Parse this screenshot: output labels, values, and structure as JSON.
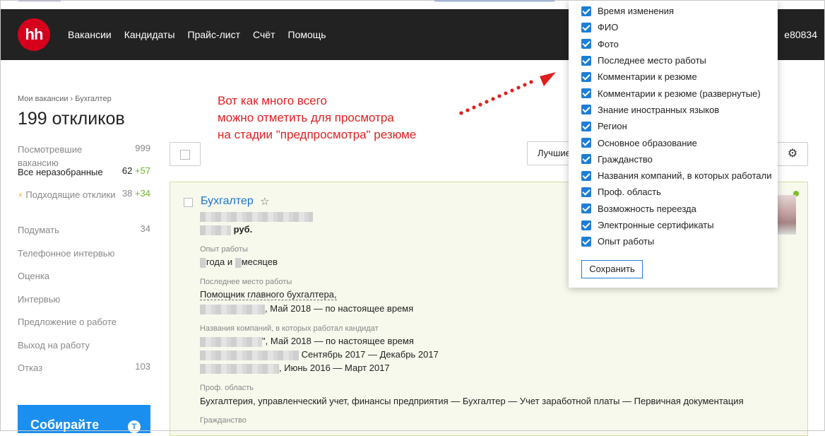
{
  "header": {
    "logo": "hh",
    "nav": [
      "Вакансии",
      "Кандидаты",
      "Прайс-лист",
      "Счёт",
      "Помощь"
    ],
    "user": "e80834"
  },
  "breadcrumb": "Мои вакансии › Бухгалтер",
  "page_title": "199 откликов",
  "sidebar": [
    {
      "label": "Посмотревшие вакансию",
      "count": "999",
      "plus": ""
    },
    {
      "label": "Все неразобранные",
      "count": "62",
      "plus": "+57"
    },
    {
      "label": "Подходящие отклики",
      "count": "38",
      "plus": "+34",
      "icon": "lightning-icon"
    },
    {
      "label": "Подумать",
      "count": "34",
      "plus": ""
    },
    {
      "label": "Телефонное интервью",
      "count": "",
      "plus": ""
    },
    {
      "label": "Оценка",
      "count": "",
      "plus": ""
    },
    {
      "label": "Интервью",
      "count": "",
      "plus": ""
    },
    {
      "label": "Предложение о работе",
      "count": "",
      "plus": ""
    },
    {
      "label": "Выход на работу",
      "count": "",
      "plus": ""
    },
    {
      "label": "Отказ",
      "count": "103",
      "plus": ""
    }
  ],
  "promo": {
    "text": "Собирайте",
    "badge": "T"
  },
  "annotation": {
    "lines": [
      "Вот как много всего",
      "можно отметить для просмотра",
      "на стадии \"предпросмотра\" резюме"
    ],
    "color": "#e02020"
  },
  "toolbar": {
    "sort_label": "Лучшие"
  },
  "card": {
    "title": "Бухгалтер",
    "salary_suffix": "руб.",
    "experience_label": "Опыт работы",
    "experience_part1": "года и",
    "experience_part2": "месяцев",
    "last_job_label": "Последнее место работы",
    "last_job_title": "Помощник главного бухгалтера,",
    "last_job_period": ", Май 2018 — по настоящее время",
    "companies_label": "Названия компаний, в которых работал кандидат",
    "companies": [
      "\", Май 2018 — по настоящее время",
      "Сентябрь 2017 — Декабрь 2017",
      ", Июнь 2016 — Март 2017"
    ],
    "prof_label": "Проф. область",
    "prof_value": "Бухгалтерия, управленческий учет, финансы предприятия — Бухгалтер — Учет заработной платы — Первичная документация",
    "citizenship_label": "Гражданство"
  },
  "dropdown": {
    "items": [
      "Время изменения",
      "ФИО",
      "Фото",
      "Последнее место работы",
      "Комментарии к резюме",
      "Комментарии к резюме (развернутые)",
      "Знание иностранных языков",
      "Регион",
      "Основное образование",
      "Гражданство",
      "Названия компаний, в которых работали",
      "Проф. область",
      "Возможность переезда",
      "Электронные сертификаты",
      "Опыт работы"
    ],
    "save_label": "Сохранить"
  },
  "colors": {
    "accent": "#1c7ed6",
    "header_bg": "#222222",
    "logo": "#d6001c",
    "plus": "#6fb32c",
    "link": "#1b75d0"
  }
}
